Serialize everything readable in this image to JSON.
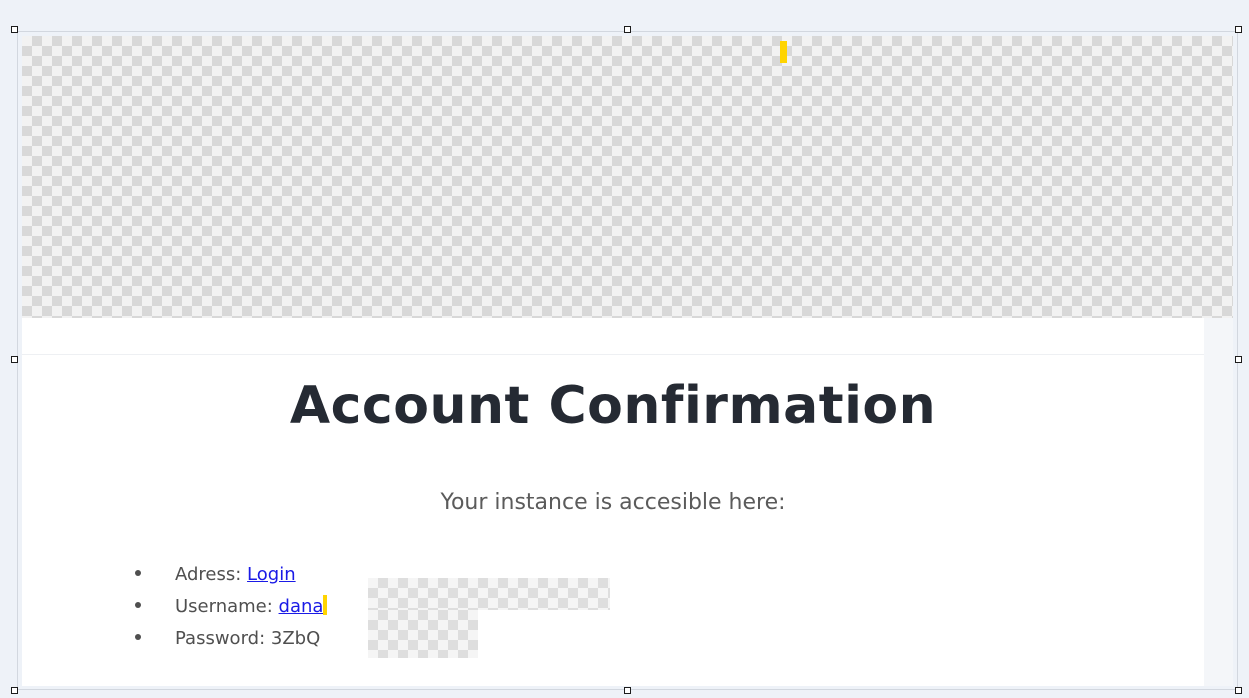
{
  "email": {
    "title": "Account Confirmation",
    "subtitle": "Your instance is accesible here:",
    "details": [
      {
        "label": "Adress: ",
        "value": "Login",
        "is_link": true
      },
      {
        "label": "Username: ",
        "value": "dana",
        "is_link": true
      },
      {
        "label": "Password: ",
        "value": "3ZbQ",
        "is_link": false
      }
    ]
  },
  "colors": {
    "title": "#252a33",
    "body_text": "#4f4f4f",
    "link": "#1a1ae6",
    "cursor": "#ffd400",
    "canvas_background": "#eef2f8"
  },
  "icons": {
    "image_placeholder": "transparency-checkerboard-image",
    "selection_handles": "resize-handle"
  }
}
